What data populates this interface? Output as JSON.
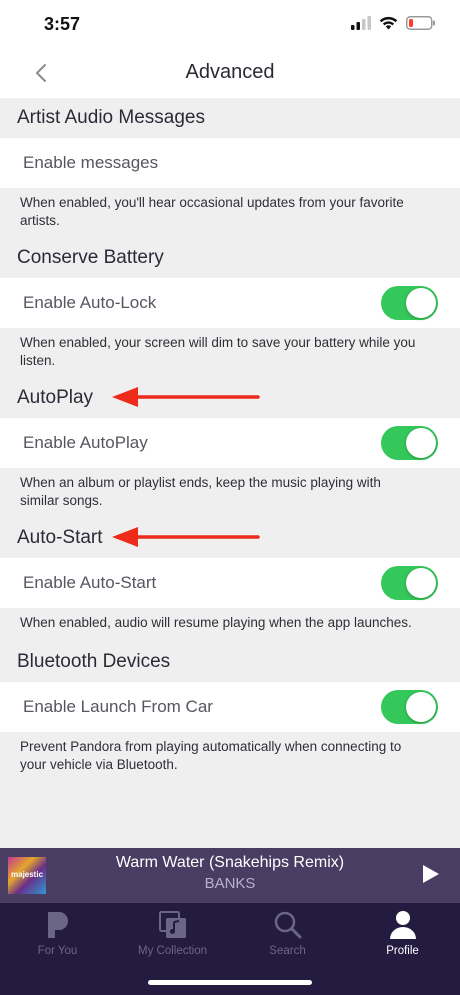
{
  "status": {
    "time": "3:57"
  },
  "nav": {
    "title": "Advanced"
  },
  "sections": [
    {
      "header": "Artist Audio Messages",
      "row": "Enable messages",
      "toggle": false,
      "desc": "When enabled, you'll hear occasional updates from your favorite artists."
    },
    {
      "header": "Conserve Battery",
      "row": "Enable Auto-Lock",
      "toggle": true,
      "desc": "When enabled, your screen will dim to save your battery while you listen."
    },
    {
      "header": "AutoPlay",
      "row": "Enable AutoPlay",
      "toggle": true,
      "arrow": true,
      "desc": "When an album or playlist ends, keep the music playing with similar songs."
    },
    {
      "header": "Auto-Start",
      "row": "Enable Auto-Start",
      "toggle": true,
      "arrow": true,
      "desc": "When enabled, audio will resume playing when the app launches."
    },
    {
      "header": "Bluetooth Devices",
      "row": "Enable Launch From Car",
      "toggle": true,
      "desc": "Prevent Pandora from playing automatically when connecting to your vehicle via Bluetooth."
    }
  ],
  "player": {
    "title": "Warm Water (Snakehips Remix)",
    "artist": "BANKS",
    "album_art_text": "majestic"
  },
  "tabs": [
    {
      "label": "For You",
      "icon": "pandora-p-icon",
      "active": false
    },
    {
      "label": "My Collection",
      "icon": "collection-icon",
      "active": false
    },
    {
      "label": "Search",
      "icon": "search-icon",
      "active": false
    },
    {
      "label": "Profile",
      "icon": "profile-icon",
      "active": true
    }
  ],
  "colors": {
    "toggle_on": "#34c759",
    "arrow": "#ee2a1b",
    "player_bg": "#4a3d63",
    "tabbar_bg": "#241c40"
  }
}
